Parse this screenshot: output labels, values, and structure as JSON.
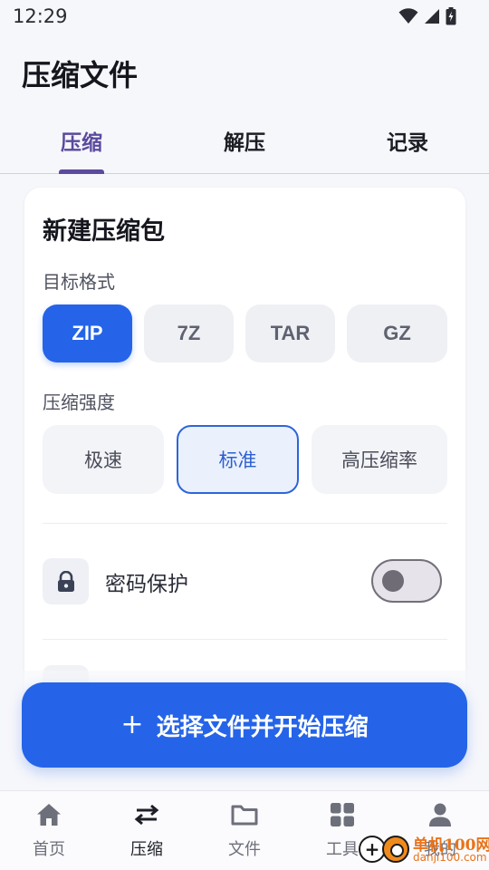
{
  "status_bar": {
    "time": "12:29"
  },
  "app": {
    "title": "压缩文件"
  },
  "tabs": [
    {
      "label": "压缩",
      "active": true
    },
    {
      "label": "解压",
      "active": false
    },
    {
      "label": "记录",
      "active": false
    }
  ],
  "card": {
    "title": "新建压缩包",
    "format_label": "目标格式",
    "formats": [
      "ZIP",
      "7Z",
      "TAR",
      "GZ"
    ],
    "selected_format": "ZIP",
    "level_label": "压缩强度",
    "levels": [
      "极速",
      "标准",
      "高压缩率"
    ],
    "selected_level": "标准",
    "password_label": "密码保护",
    "password_enabled": false
  },
  "cta": {
    "plus": "+",
    "label": "选择文件并开始压缩"
  },
  "bottom_nav": [
    {
      "label": "首页",
      "icon": "home-icon",
      "active": false
    },
    {
      "label": "压缩",
      "icon": "swap-arrows-icon",
      "active": true
    },
    {
      "label": "文件",
      "icon": "folder-icon",
      "active": false
    },
    {
      "label": "工具",
      "icon": "grid-icon",
      "active": false
    },
    {
      "label": "我的",
      "icon": "person-icon",
      "active": false
    }
  ],
  "watermark": {
    "brand": "单机100网",
    "url": "danji100.com"
  },
  "colors": {
    "accent": "#2564e8",
    "tab_active": "#5b4a9e",
    "background": "#f6f7fb"
  }
}
